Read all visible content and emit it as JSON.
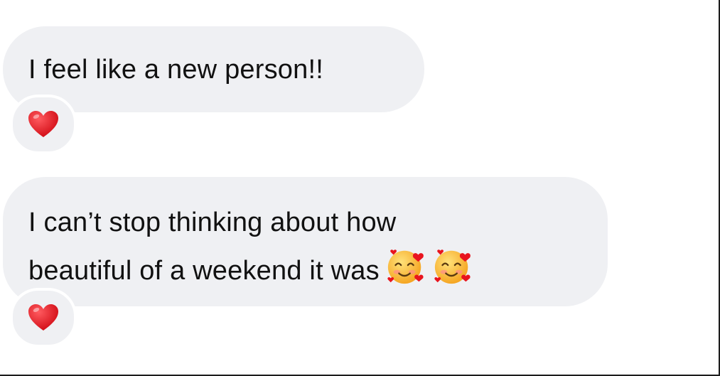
{
  "messages": [
    {
      "lines": [
        "I feel like a new person!!"
      ],
      "reaction": "red-heart-icon"
    },
    {
      "lines": [
        "I can’t stop thinking about how",
        "beautiful of a weekend it was"
      ],
      "trailing_emoji": [
        "smiling-face-with-hearts-icon",
        "smiling-face-with-hearts-icon"
      ],
      "reaction": "red-heart-icon"
    }
  ],
  "colors": {
    "bubble": "#eff0f3",
    "text": "#111111",
    "heart": "#e8141e",
    "emoji_face": "#ffc83a"
  }
}
